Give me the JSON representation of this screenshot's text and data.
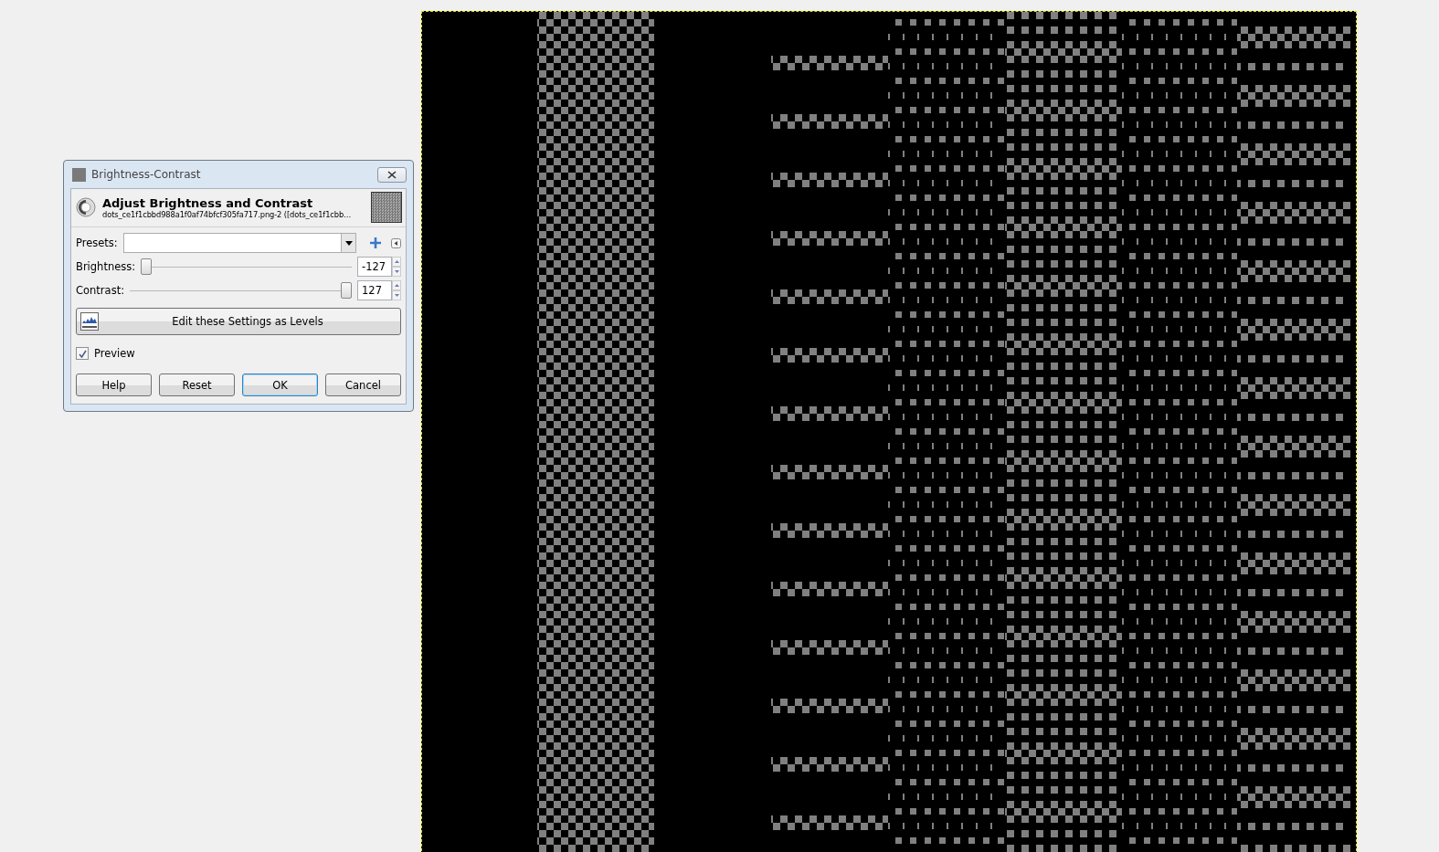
{
  "dialog": {
    "title": "Brightness-Contrast",
    "header_title": "Adjust Brightness and Contrast",
    "header_subtitle": "dots_ce1f1cbbd988a1f0af74bfcf305fa717.png-2 ([dots_ce1f1cbb…",
    "presets_label": "Presets:",
    "sliders": [
      {
        "label": "Brightness:",
        "value": "-127",
        "level": 0
      },
      {
        "label": "Contrast:",
        "value": "127",
        "level": 1
      }
    ],
    "levels_button": "Edit these Settings as Levels",
    "preview": {
      "label": "Preview",
      "checked": true
    },
    "buttons": [
      {
        "label": "Help",
        "selected": false
      },
      {
        "label": "Reset",
        "selected": false
      },
      {
        "label": "OK",
        "selected": true
      },
      {
        "label": "Cancel",
        "selected": false
      }
    ]
  }
}
